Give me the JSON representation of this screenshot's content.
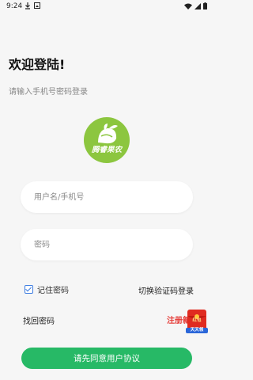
{
  "status_bar": {
    "time": "9:24"
  },
  "header": {
    "title": "欢迎登陆!",
    "subtitle": "请输入手机号密码登录"
  },
  "logo": {
    "text": "腾睿果农",
    "color": "#8cc63f"
  },
  "form": {
    "username_placeholder": "用户名/手机号",
    "password_placeholder": "密码",
    "username_value": "",
    "password_value": ""
  },
  "options": {
    "remember_label": "记住密码",
    "remember_checked": true,
    "switch_label": "切换验证码登录",
    "forgot_label": "找回密码",
    "register_label": "注册新"
  },
  "promo": {
    "line1": "红包",
    "line2": "天天领"
  },
  "actions": {
    "agree_label": "请先同意用户协议"
  },
  "colors": {
    "accent": "#27b966",
    "register": "#e53935",
    "checkbox": "#3b7be0"
  }
}
